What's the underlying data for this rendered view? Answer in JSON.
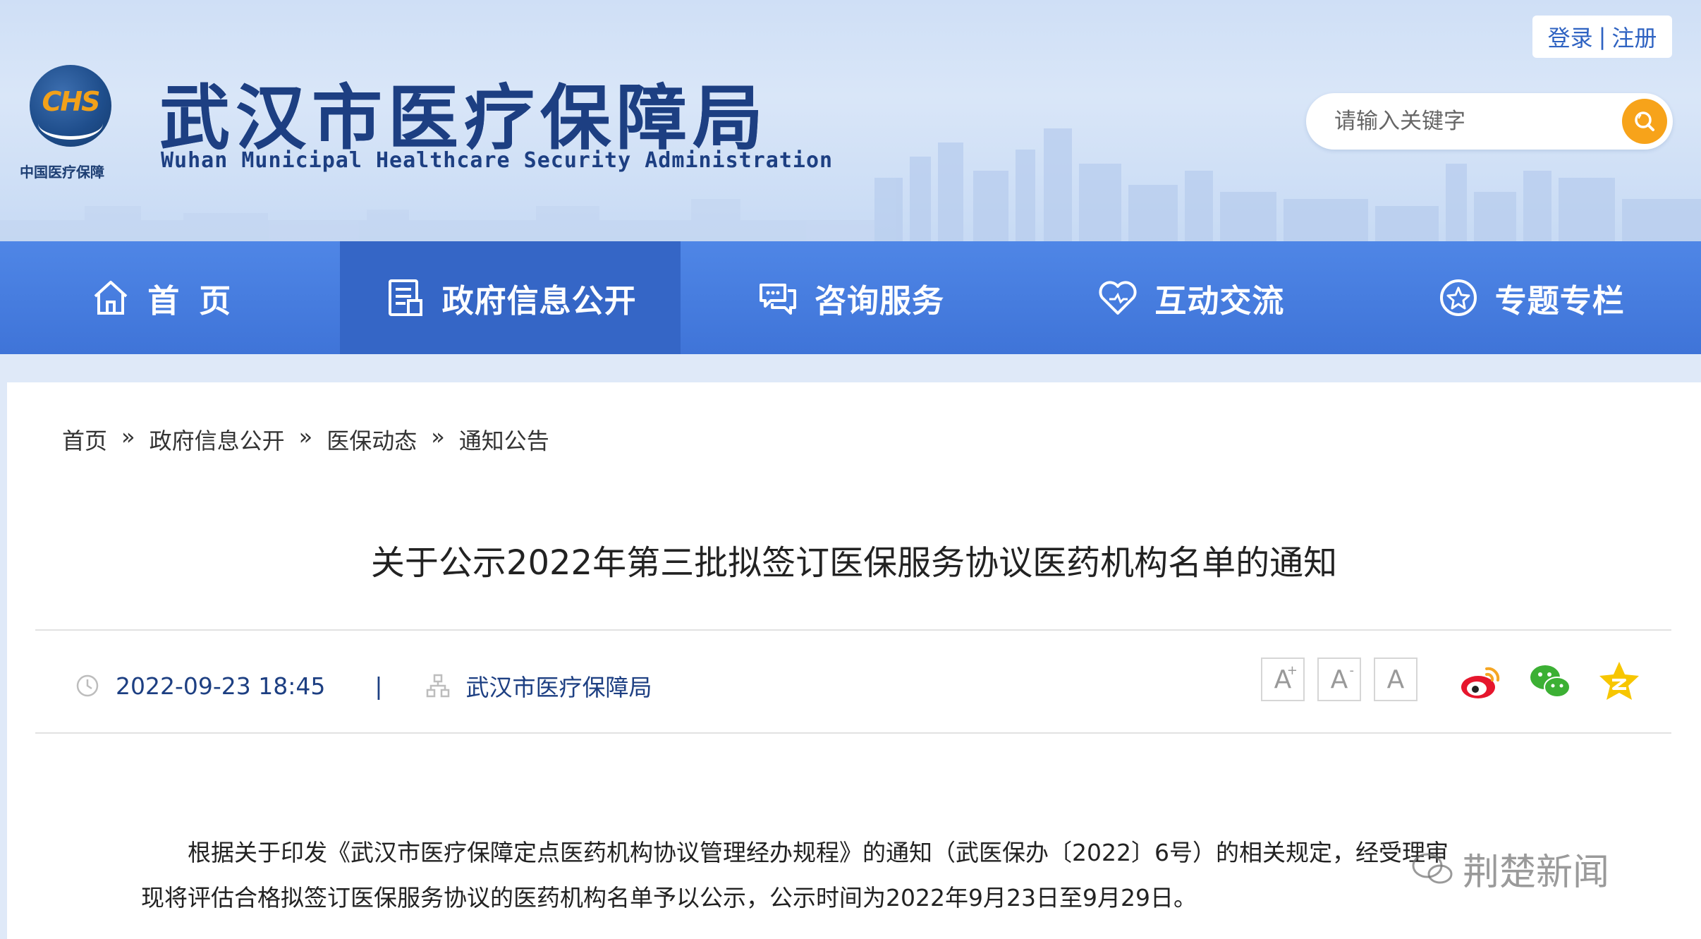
{
  "header": {
    "logo_text": "CHS",
    "logo_caption": "中国医疗保障",
    "title": "武汉市医疗保障局",
    "subtitle": "Wuhan Municipal Healthcare Security Administration",
    "auth": {
      "login": "登录",
      "separator": "|",
      "register": "注册"
    },
    "search": {
      "placeholder": "请输入关键字",
      "button_color": "#f7a31a"
    }
  },
  "nav": {
    "items": [
      {
        "label": "首页",
        "icon": "home-icon"
      },
      {
        "label": "政府信息公开",
        "icon": "document-list-icon",
        "active": true
      },
      {
        "label": "咨询服务",
        "icon": "chat-bubble-icon"
      },
      {
        "label": "互动交流",
        "icon": "heart-icon"
      },
      {
        "label": "专题专栏",
        "icon": "star-circle-icon"
      }
    ]
  },
  "breadcrumb": {
    "items": [
      "首页",
      "政府信息公开",
      "医保动态",
      "通知公告"
    ],
    "separator": "»"
  },
  "article": {
    "title": "关于公示2022年第三批拟签订医保服务协议医药机构名单的通知",
    "date": "2022-09-23 18:45",
    "meta_separator": "|",
    "source": "武汉市医疗保障局",
    "font_controls": [
      "A",
      "A",
      "A"
    ],
    "share": [
      "weibo-icon",
      "wechat-icon",
      "qzone-icon"
    ],
    "paragraph_1": "根据关于印发《武汉市医疗保障定点医药机构协议管理经办规程》的通知（武医保办〔2022〕6号）的相关规定，经受理审",
    "paragraph_2": "现将评估合格拟签订医保服务协议的医药机构名单予以公示，公示时间为2022年9月23日至9月29日。"
  },
  "watermark": "荆楚新闻",
  "colors": {
    "nav": "#3f74d8",
    "nav_active": "#3566c6",
    "title_blue": "#1d3f82",
    "accent_orange": "#f7a31a"
  }
}
